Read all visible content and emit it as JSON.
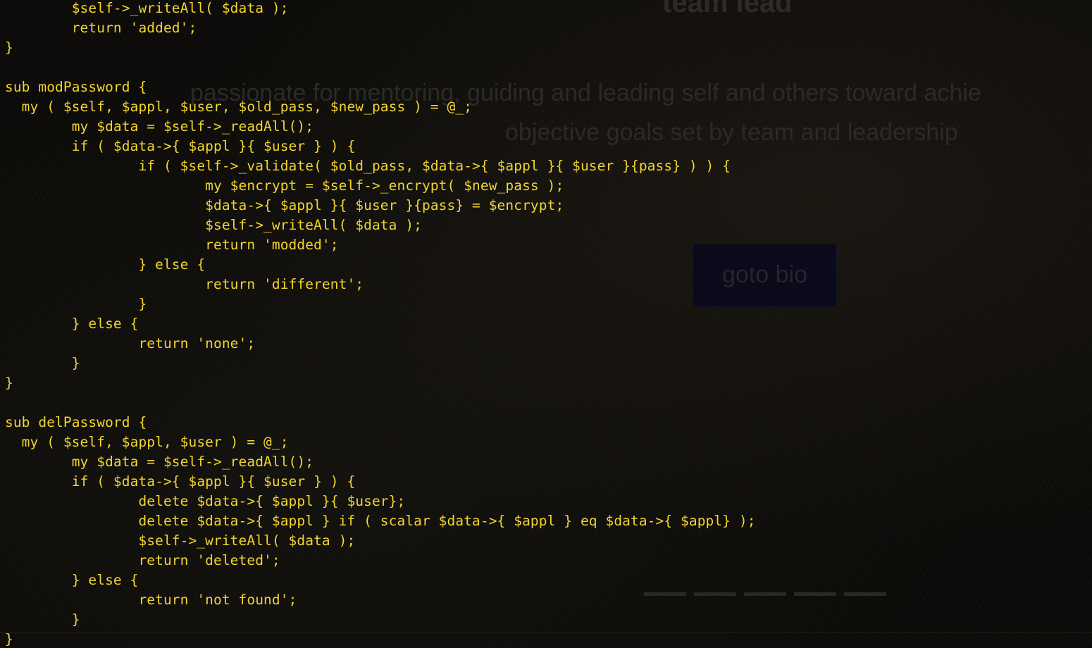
{
  "website": {
    "heading": "team lead",
    "tagline_line1": "passionate for mentoring, guiding and leading self and others toward achie",
    "tagline_line2": "objective goals set by team and leadership",
    "goto_button": "goto bio",
    "carousel_dots": 5
  },
  "terminal": {
    "text_color": "#f2d52e",
    "lines": [
      "        $self->_writeAll( $data );",
      "        return 'added';",
      "}",
      "",
      "sub modPassword {",
      "  my ( $self, $appl, $user, $old_pass, $new_pass ) = @_;",
      "        my $data = $self->_readAll();",
      "        if ( $data->{ $appl }{ $user } ) {",
      "                if ( $self->_validate( $old_pass, $data->{ $appl }{ $user }{pass} ) ) {",
      "                        my $encrypt = $self->_encrypt( $new_pass );",
      "                        $data->{ $appl }{ $user }{pass} = $encrypt;",
      "                        $self->_writeAll( $data );",
      "                        return 'modded';",
      "                } else {",
      "                        return 'different';",
      "                }",
      "        } else {",
      "                return 'none';",
      "        }",
      "}",
      "",
      "sub delPassword {",
      "  my ( $self, $appl, $user ) = @_;",
      "        my $data = $self->_readAll();",
      "        if ( $data->{ $appl }{ $user } ) {",
      "                delete $data->{ $appl }{ $user};",
      "                delete $data->{ $appl } if ( scalar $data->{ $appl } eq $data->{ $appl} );",
      "                $self->_writeAll( $data );",
      "                return 'deleted';",
      "        } else {",
      "                return 'not found';",
      "        }",
      "}"
    ]
  }
}
